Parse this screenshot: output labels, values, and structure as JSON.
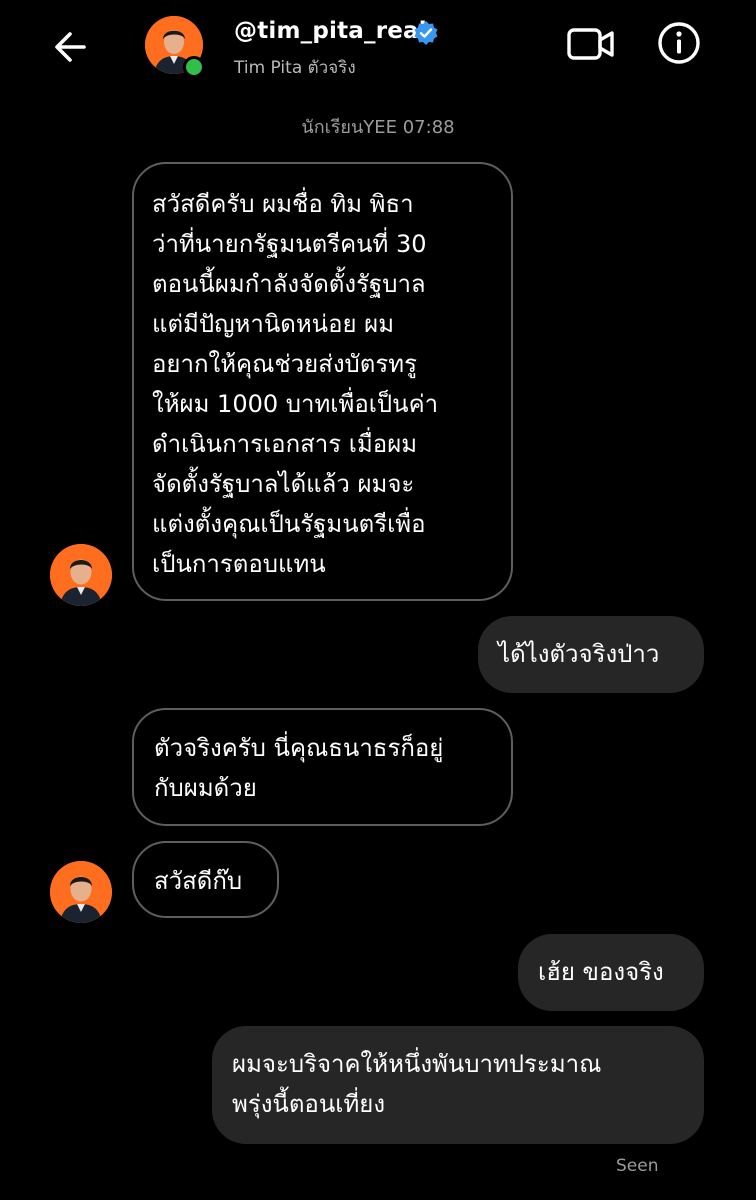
{
  "header": {
    "username": "@tim_pita_real",
    "subname": "Tim Pita ตัวจริง",
    "back_icon": "arrow-left-icon",
    "video_icon": "video-camera-icon",
    "info_icon": "info-icon",
    "verified_icon": "verified-badge-icon",
    "online_color": "#2fbf4a"
  },
  "timestamp": "นักเรียนYEE 07:88",
  "messages": [
    {
      "direction": "incoming",
      "lines": [
        "สวัสดีครับ ผมชื่อ ทิม พิธา",
        "ว่าที่นายกรัฐมนตรีคนที่ 30",
        "ตอนนี้ผมกำลังจัดตั้งรัฐบาล",
        "แต่มีปัญหานิดหน่อย ผม",
        "อยากให้คุณช่วยส่งบัตรทรู",
        "ให้ผม 1000 บาทเพื่อเป็นค่า",
        "ดำเนินการเอกสาร เมื่อผม",
        "จัดตั้งรัฐบาลได้แล้ว ผมจะ",
        "แต่งตั้งคุณเป็นรัฐมนตรีเพื่อ",
        "เป็นการตอบแทน"
      ]
    },
    {
      "direction": "outgoing",
      "lines": [
        "ได้ไงตัวจริงป่าว"
      ]
    },
    {
      "direction": "incoming",
      "lines": [
        "ตัวจริงครับ นี่คุณธนาธรก็อยู่",
        "กับผมด้วย"
      ]
    },
    {
      "direction": "incoming",
      "lines": [
        "สวัสดีก๊บ"
      ]
    },
    {
      "direction": "outgoing",
      "lines": [
        "เฮ้ย ของจริง"
      ]
    },
    {
      "direction": "outgoing",
      "lines": [
        "ผมจะบริจาคให้หนึ่งพันบาทประมาณ",
        "พรุ่งนี้ตอนเที่ยง"
      ]
    }
  ],
  "seen_label": "Seen",
  "colors": {
    "background": "#000000",
    "incoming_border": "#5e5e5e",
    "outgoing_bg": "#262626",
    "avatar_bg": "#ff6d1f",
    "verified": "#3897f0"
  }
}
